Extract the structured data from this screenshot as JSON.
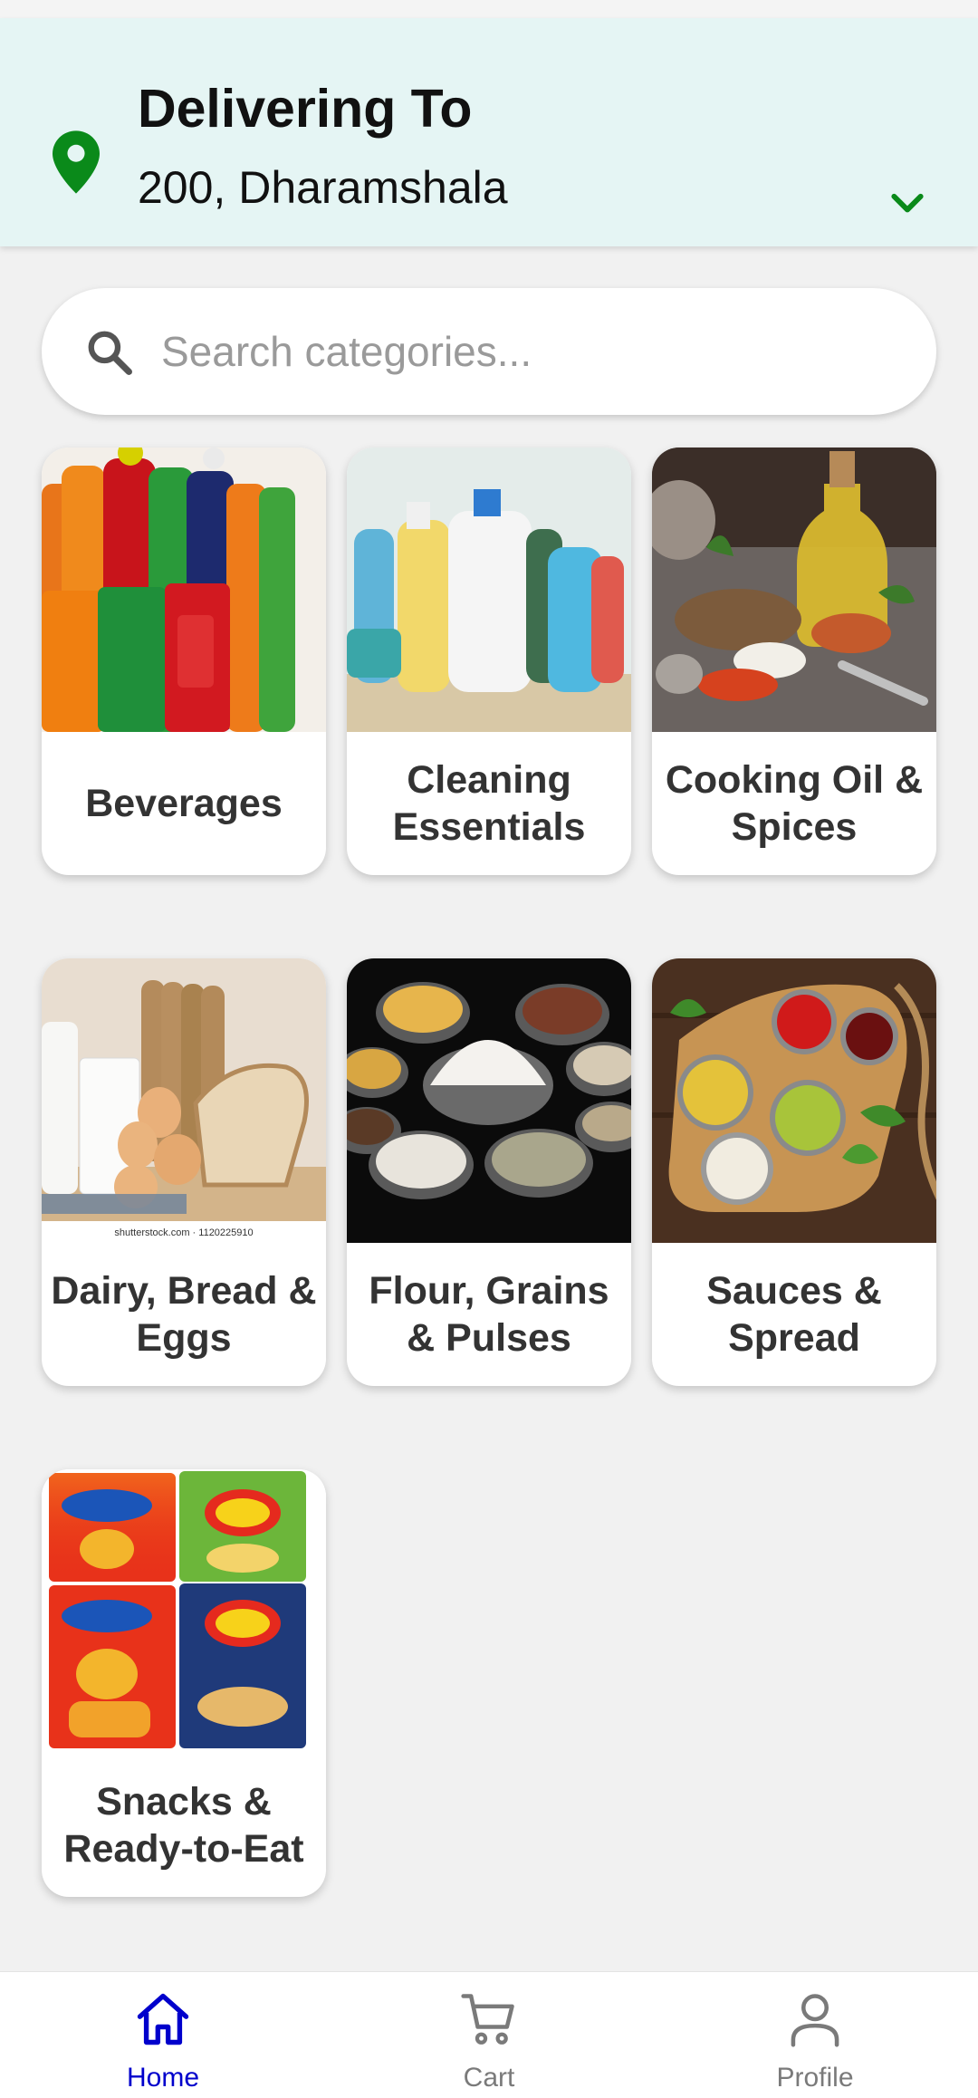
{
  "header": {
    "title": "Delivering To",
    "address": "200, Dharamshala",
    "accent_color": "#0a8a1a"
  },
  "search": {
    "placeholder": "Search categories..."
  },
  "categories": [
    {
      "label": "Beverages",
      "icon": "beverages-image"
    },
    {
      "label": "Cleaning Essentials",
      "icon": "cleaning-image"
    },
    {
      "label": "Cooking Oil & Spices",
      "icon": "oil-spices-image"
    },
    {
      "label": "Dairy, Bread & Eggs",
      "icon": "dairy-image"
    },
    {
      "label": "Flour, Grains & Pulses",
      "icon": "grains-image"
    },
    {
      "label": "Sauces & Spread",
      "icon": "sauces-image"
    },
    {
      "label": "Snacks & Ready-to-Eat",
      "icon": "snacks-image"
    }
  ],
  "image_texts": {
    "dairy_watermark": "shutterstock.com · 1120225910"
  },
  "nav": {
    "items": [
      {
        "label": "Home",
        "icon": "home-icon",
        "active": true
      },
      {
        "label": "Cart",
        "icon": "cart-icon",
        "active": false
      },
      {
        "label": "Profile",
        "icon": "profile-icon",
        "active": false
      }
    ],
    "active_color": "#0000cc",
    "inactive_color": "#7a7a7a"
  }
}
